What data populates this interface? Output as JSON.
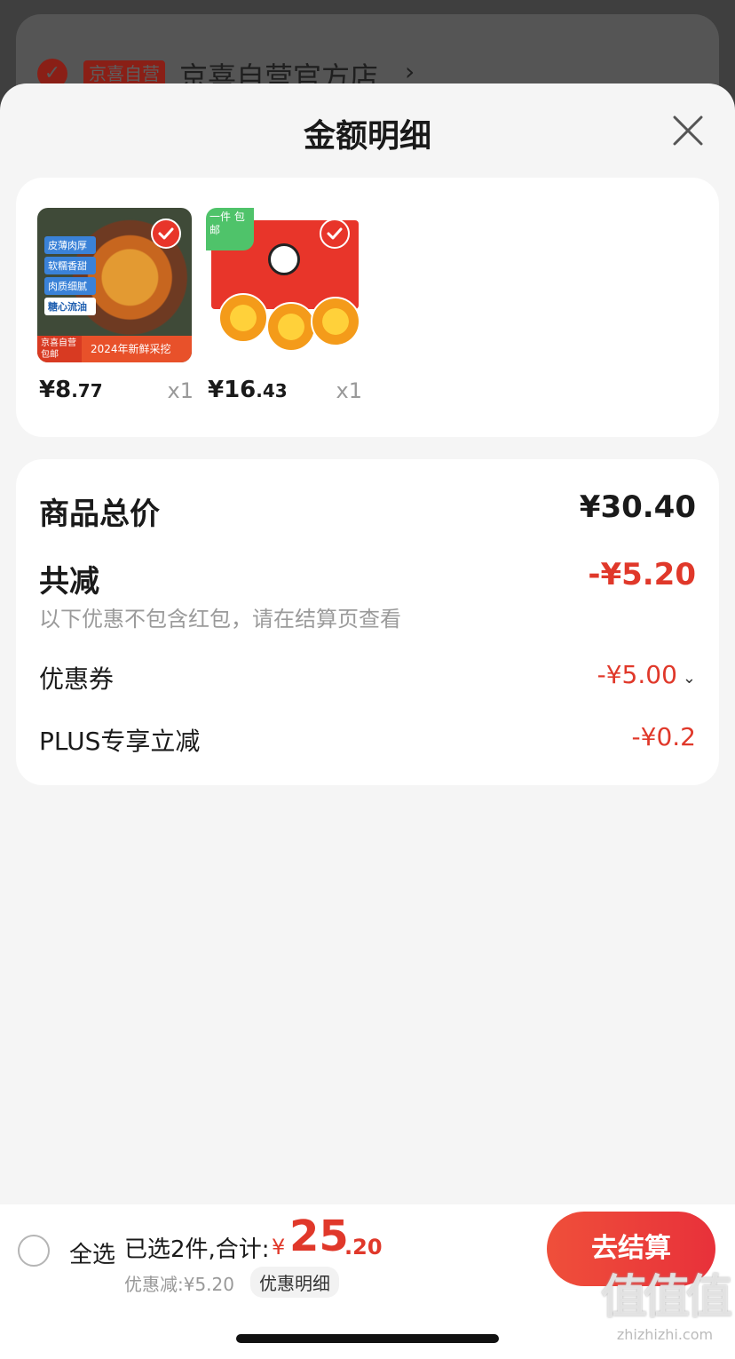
{
  "background": {
    "badge": "京喜自营",
    "store_name": "京喜自营官方店",
    "chevron": "›"
  },
  "sheet": {
    "title": "金额明细",
    "close_icon": "close-icon"
  },
  "products": [
    {
      "price_int": "¥8",
      "price_dec": ".77",
      "qty": "x1",
      "image_tags": [
        "皮薄肉厚",
        "软糯香甜",
        "肉质细腻",
        "糖心流油"
      ],
      "image_footer_left": "京喜自营 包邮",
      "image_footer_right": "2024年新鲜采挖"
    },
    {
      "price_int": "¥16",
      "price_dec": ".43",
      "qty": "x1",
      "image_corner": "一件 包邮"
    }
  ],
  "summary": {
    "total_label": "商品总价",
    "total_value": "¥30.40",
    "reduce_label": "共减",
    "reduce_value": "-¥5.20",
    "note": "以下优惠不包含红包，请在结算页查看",
    "coupon_label": "优惠券",
    "coupon_value": "-¥5.00",
    "plus_label": "PLUS专享立减",
    "plus_value": "-¥0.2"
  },
  "bottom_bar": {
    "select_all": "全选",
    "selected_text": "已选2件,合计:",
    "currency": "¥",
    "total_int": "25",
    "total_dec": ".20",
    "discount_text": "优惠减:¥5.20",
    "detail_button": "优惠明细",
    "checkout_button": "去结算"
  },
  "watermark": {
    "big": "值值值",
    "small": "zhizhizhi.com"
  },
  "colors": {
    "accent_red": "#e0382a",
    "sheet_bg": "#f5f5f5",
    "card_bg": "#ffffff"
  }
}
